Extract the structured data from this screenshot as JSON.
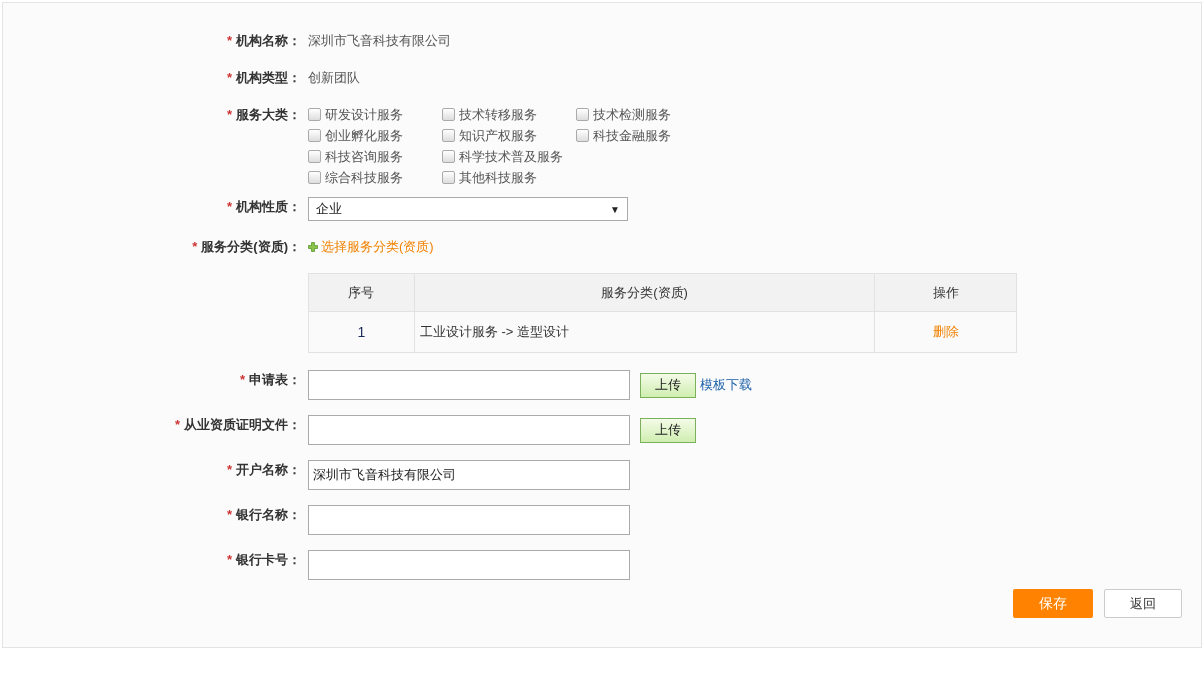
{
  "fields": [
    {
      "kind": "text",
      "mark": "*",
      "label": "机构名称：",
      "value": "深圳市飞音科技有限公司"
    },
    {
      "kind": "text",
      "mark": "*",
      "label": "机构类型：",
      "value": "创新团队"
    },
    {
      "kind": "checkboxes",
      "mark": "*",
      "label": "服务大类：",
      "option_rows": [
        [
          {
            "label": "研发设计服务",
            "checked": false
          },
          {
            "label": "技术转移服务",
            "checked": false
          },
          {
            "label": "技术检测服务",
            "checked": false
          }
        ],
        [
          {
            "label": "创业孵化服务",
            "checked": false
          },
          {
            "label": "知识产权服务",
            "checked": false
          },
          {
            "label": "科技金融服务",
            "checked": false
          }
        ],
        [
          {
            "label": "科技咨询服务",
            "checked": false
          },
          {
            "label": "科学技术普及服务",
            "checked": false
          }
        ],
        [
          {
            "label": "综合科技服务",
            "checked": false
          },
          {
            "label": "其他科技服务",
            "checked": false
          }
        ]
      ]
    },
    {
      "kind": "select",
      "mark": "*",
      "label": "机构性质：",
      "value": "企业",
      "arrow": "▼"
    },
    {
      "kind": "link",
      "mark": "*",
      "label": "服务分类(资质)：",
      "link": "选择服务分类(资质)",
      "table": {
        "columns": [
          "序号",
          "服务分类(资质)",
          "操作"
        ],
        "rows": [
          {
            "index": "1",
            "classification": "工业设计服务 -> 造型设计",
            "action": "删除"
          }
        ]
      }
    },
    {
      "kind": "file",
      "mark": "*",
      "label": "申请表：",
      "button": "上传",
      "extra_link": "模板下载"
    },
    {
      "kind": "file",
      "mark": "*",
      "label": "从业资质证明文件：",
      "button": "上传"
    },
    {
      "kind": "input",
      "mark": "*",
      "label": "开户名称：",
      "value": "深圳市飞音科技有限公司"
    },
    {
      "kind": "input",
      "mark": "*",
      "label": "银行名称："
    },
    {
      "kind": "input",
      "mark": "*",
      "label": "银行卡号："
    }
  ],
  "buttons": [
    {
      "label": "保存",
      "primary": true
    },
    {
      "label": "返回",
      "primary": false
    }
  ]
}
